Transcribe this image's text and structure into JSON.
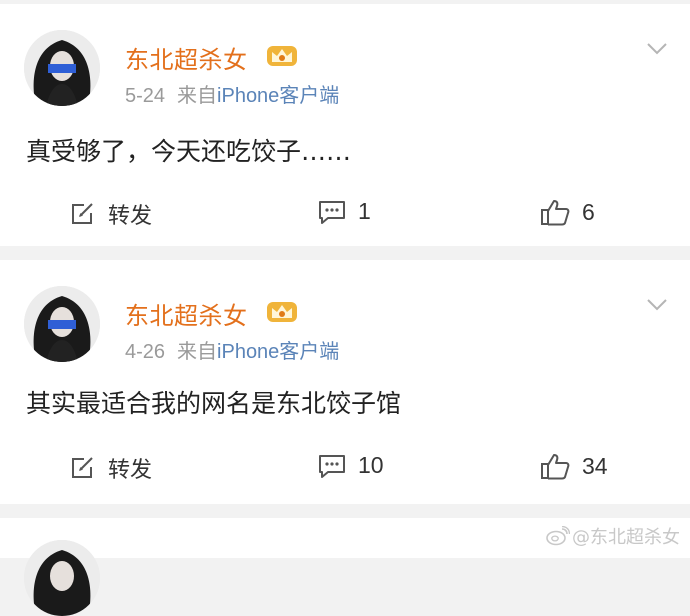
{
  "posts": [
    {
      "author": "东北超杀女",
      "date": "5-24",
      "source_prefix": "来自",
      "source": "iPhone客户端",
      "content": "真受够了，今天还吃饺子……",
      "repost_label": "转发",
      "comment_count": "1",
      "like_count": "6"
    },
    {
      "author": "东北超杀女",
      "date": "4-26",
      "source_prefix": "来自",
      "source": "iPhone客户端",
      "content": "其实最适合我的网名是东北饺子馆",
      "repost_label": "转发",
      "comment_count": "10",
      "like_count": "34"
    }
  ],
  "watermark": "@东北超杀女",
  "colors": {
    "author_name": "#e3701c",
    "source_link": "#5b84b8",
    "meta_gray": "#9a9a9a",
    "page_bg": "#f2f2f2",
    "crown_gold": "#f0b43a"
  },
  "icons": {
    "avatar": "avatar-photo",
    "badge": "crown-icon",
    "menu": "chevron-down-icon",
    "repost": "repost-icon",
    "comment": "comment-icon",
    "like": "thumbs-up-icon",
    "watermark_logo": "weibo-logo-icon"
  }
}
